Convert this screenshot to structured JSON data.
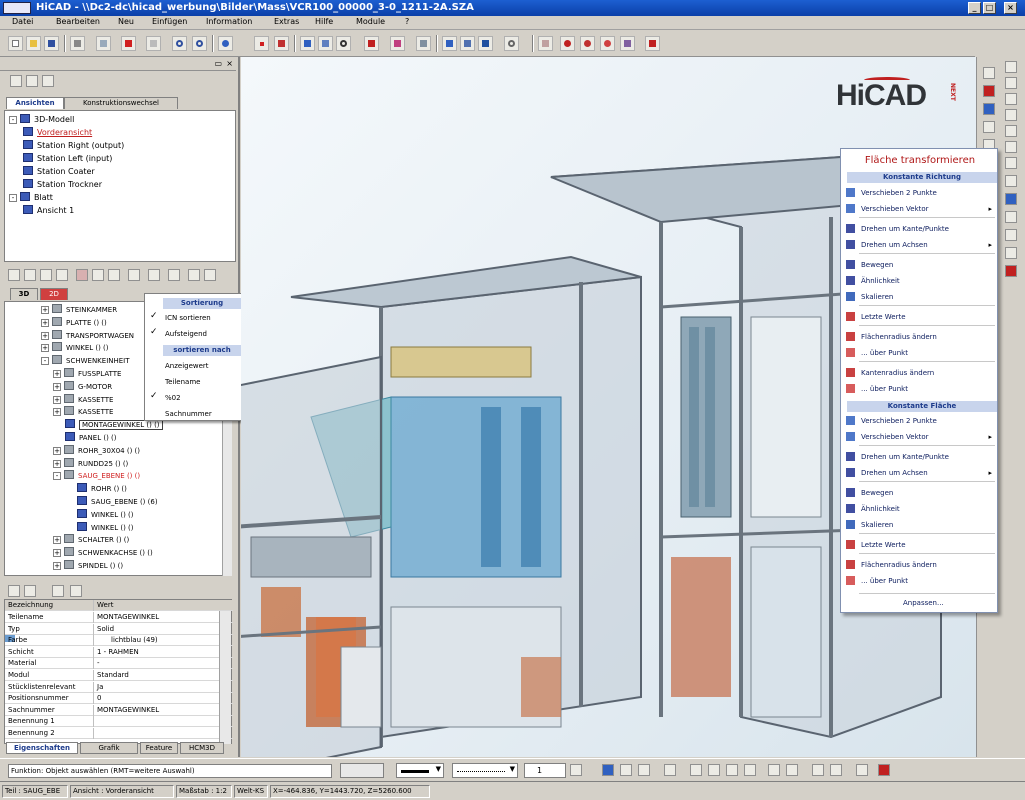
{
  "window": {
    "title": "HiCAD - \\\\Dc2-dc\\hicad_werbung\\Bilder\\Mass\\VCR100_00000_3-0_1211-2A.SZA"
  },
  "menu": [
    "Datei",
    "Bearbeiten",
    "Neu",
    "Einfügen",
    "Information",
    "Extras",
    "Hilfe",
    "Module",
    "?"
  ],
  "logo": {
    "text": "HiCAD",
    "suffix": "NEXT"
  },
  "left_panel": {
    "tabs": [
      "Ansichten",
      "Konstruktionswechsel"
    ],
    "tree1": [
      {
        "label": "3D-Modell",
        "level": 0,
        "exp": "-"
      },
      {
        "label": "Vorderansicht",
        "level": 1,
        "active": true
      },
      {
        "label": "Station Right (output)",
        "level": 1
      },
      {
        "label": "Station Left (input)",
        "level": 1
      },
      {
        "label": "Station Coater",
        "level": 1
      },
      {
        "label": "Station Trockner",
        "level": 1
      },
      {
        "label": "Blatt",
        "level": 0,
        "exp": "-"
      },
      {
        "label": "Ansicht 1",
        "level": 1
      }
    ],
    "tabs2": [
      "3D",
      "2D"
    ],
    "tree2": [
      {
        "label": "STEINKAMMER",
        "level": 3,
        "exp": "+"
      },
      {
        "label": "PLATTE () ()",
        "level": 3,
        "exp": "+"
      },
      {
        "label": "TRANSPORTWAGEN",
        "level": 3,
        "exp": "+"
      },
      {
        "label": "WINKEL () ()",
        "level": 3,
        "exp": "+"
      },
      {
        "label": "SCHWENKEINHEIT",
        "level": 3,
        "exp": "-"
      },
      {
        "label": "FUSSPLATTE",
        "level": 4,
        "exp": "+"
      },
      {
        "label": "G-MOTOR",
        "level": 4,
        "exp": "+"
      },
      {
        "label": "KASSETTE",
        "level": 4,
        "exp": "+"
      },
      {
        "label": "KASSETTE",
        "level": 4,
        "exp": "+"
      },
      {
        "label": "MONTAGEWINKEL () ()",
        "level": 5,
        "boxed": true
      },
      {
        "label": "PANEL () ()",
        "level": 5
      },
      {
        "label": "ROHR_30X04 () ()",
        "level": 4,
        "exp": "+"
      },
      {
        "label": "RUNDD25 () ()",
        "level": 4,
        "exp": "+"
      },
      {
        "label": "SAUG_EBENE () ()",
        "level": 4,
        "exp": "-",
        "red": true
      },
      {
        "label": "ROHR () ()",
        "level": 6
      },
      {
        "label": "SAUG_EBENE () (6)",
        "level": 6
      },
      {
        "label": "WINKEL () ()",
        "level": 6
      },
      {
        "label": "WINKEL () ()",
        "level": 6
      },
      {
        "label": "SCHALTER () ()",
        "level": 4,
        "exp": "+"
      },
      {
        "label": "SCHWENKACHSE () ()",
        "level": 4,
        "exp": "+"
      },
      {
        "label": "SPINDEL () ()",
        "level": 4,
        "exp": "+"
      }
    ],
    "context_menu": {
      "header1": "Sortierung",
      "item1": "ICN sortieren",
      "item2": "Aufsteigend",
      "header2": "sortieren nach",
      "item3": "Anzeigewert",
      "item4": "Teilename",
      "item5": "%02",
      "item6": "Sachnummer"
    },
    "props_header": {
      "col1": "Bezeichnung",
      "col2": "Wert"
    },
    "props": [
      {
        "k": "Teilename",
        "v": "MONTAGEWINKEL"
      },
      {
        "k": "Typ",
        "v": "Solid"
      },
      {
        "k": "Farbe",
        "v": "lichtblau (49)"
      },
      {
        "k": "Schicht",
        "v": "1 - RAHMEN"
      },
      {
        "k": "Material",
        "v": "-"
      },
      {
        "k": "Modul",
        "v": "Standard"
      },
      {
        "k": "Stücklistenrelevant",
        "v": "Ja"
      },
      {
        "k": "Positionsnummer",
        "v": "0"
      },
      {
        "k": "Sachnummer",
        "v": "MONTAGEWINKEL"
      },
      {
        "k": "Benennung 1",
        "v": ""
      },
      {
        "k": "Benennung 2",
        "v": ""
      }
    ],
    "bottom_tabs": [
      "Eigenschaften",
      "Grafik",
      "Feature",
      "HCM3D"
    ]
  },
  "flyout": {
    "title": "Fläche transformieren",
    "section1": "Konstante Richtung",
    "section2": "Konstante Fläche",
    "items1": [
      {
        "label": "Verschieben 2 Punkte",
        "arrow": false
      },
      {
        "label": "Verschieben Vektor",
        "arrow": true
      },
      {
        "label": "Drehen um Kante/Punkte",
        "arrow": false
      },
      {
        "label": "Drehen um Achsen",
        "arrow": true
      },
      {
        "label": "Bewegen",
        "arrow": false
      },
      {
        "label": "Ähnlichkeit",
        "arrow": false
      },
      {
        "label": "Skalieren",
        "arrow": false
      },
      {
        "label": "Letzte Werte",
        "arrow": false
      },
      {
        "label": "Flächenradius ändern",
        "arrow": false
      },
      {
        "label": "... über Punkt",
        "arrow": false
      },
      {
        "label": "Kantenradius ändern",
        "arrow": false
      },
      {
        "label": "... über Punkt",
        "arrow": false
      }
    ],
    "items2": [
      {
        "label": "Verschieben 2 Punkte",
        "arrow": false
      },
      {
        "label": "Verschieben Vektor",
        "arrow": true
      },
      {
        "label": "Drehen um Kante/Punkte",
        "arrow": false
      },
      {
        "label": "Drehen um Achsen",
        "arrow": true
      },
      {
        "label": "Bewegen",
        "arrow": false
      },
      {
        "label": "Ähnlichkeit",
        "arrow": false
      },
      {
        "label": "Skalieren",
        "arrow": false
      },
      {
        "label": "Letzte Werte",
        "arrow": false
      },
      {
        "label": "Flächenradius ändern",
        "arrow": false
      },
      {
        "label": "... über Punkt",
        "arrow": false
      }
    ],
    "footer": "Anpassen..."
  },
  "cmdline": {
    "prompt": "Funktion: Objekt auswählen (RMT=weitere Auswahl)",
    "scale_value": "1"
  },
  "status": {
    "part": "Teil : SAUG_EBE",
    "view": "Ansicht : Vorderansicht",
    "scale": "Maßstab : 1:2",
    "world": "Welt-KS",
    "coords": "X=-464.836, Y=1443.720, Z=5260.600"
  },
  "colors": {
    "accent": "#1e3c8c",
    "title_red": "#b01818",
    "selection_blue": "#3c5bb8"
  }
}
